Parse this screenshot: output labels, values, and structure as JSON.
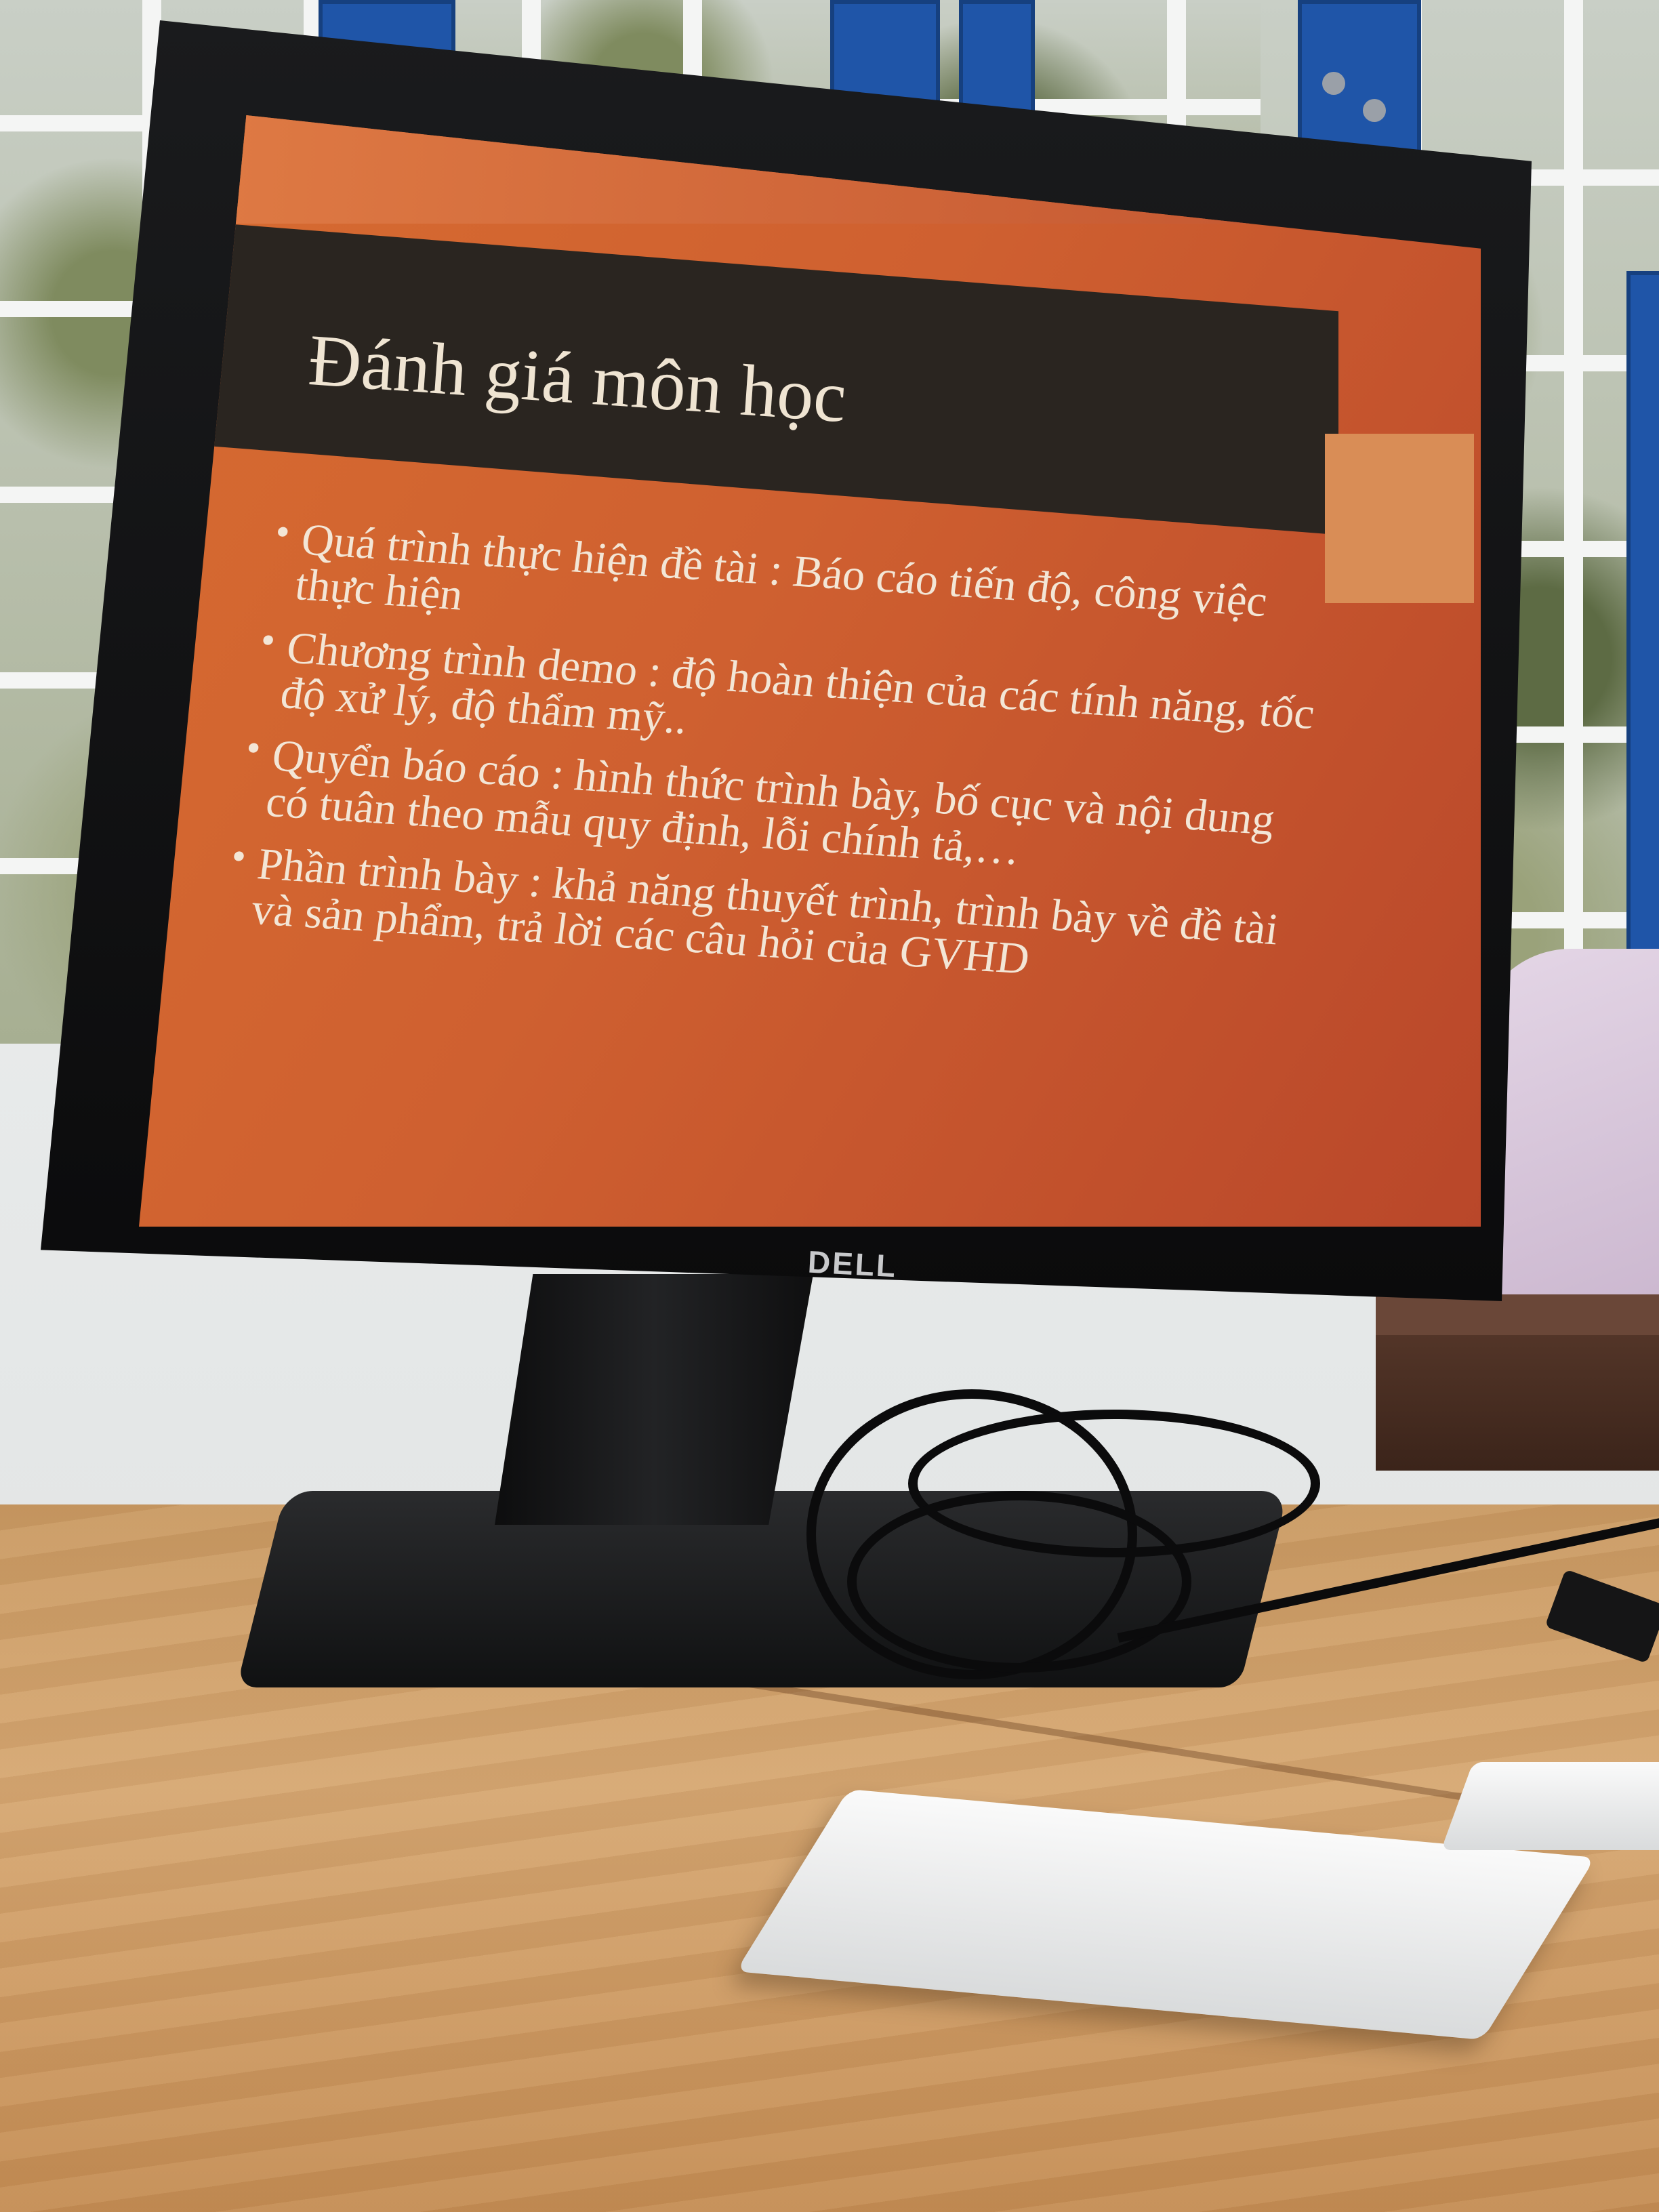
{
  "slide": {
    "title": "Đánh giá môn học",
    "bullets": [
      "Quá trình thực hiện đề tài : Báo cáo tiến độ, công việc thực hiện",
      "Chương trình demo : độ hoàn thiện của các tính năng, tốc độ xử lý, độ thẩm mỹ..",
      "Quyển báo cáo : hình thức trình bày, bố cục và nội dung có tuân theo mẫu quy định, lỗi chính tả,…",
      "Phần trình bày : khả năng thuyết trình, trình bày về đề tài và sản phẩm, trả lời các câu hỏi của GVHD"
    ]
  },
  "monitor": {
    "brand": "DELL"
  },
  "colors": {
    "slide_orange": "#cf6030",
    "title_bar": "#2a2520",
    "text": "#f3e6d6",
    "shutter_blue": "#1f55a8",
    "table_wood": "#d6a874"
  }
}
